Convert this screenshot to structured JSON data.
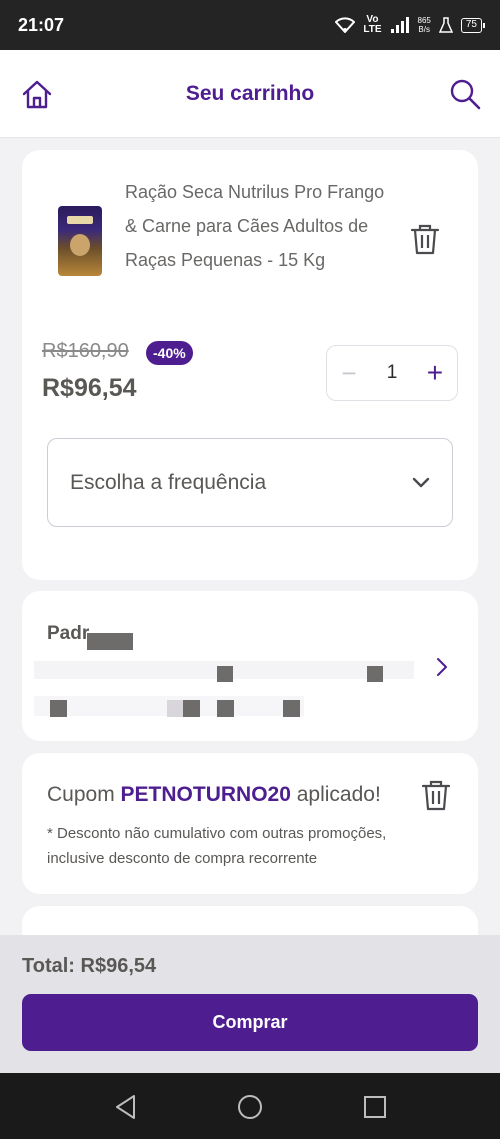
{
  "status_bar": {
    "time": "21:07",
    "network": "Vo\nLTE",
    "speed_value": "865",
    "speed_unit": "B/s",
    "battery": "75"
  },
  "header": {
    "title": "Seu carrinho"
  },
  "cart_item": {
    "name": "Ração Seca Nutrilus Pro Frango & Carne para Cães Adultos de Raças Pequenas - 15 Kg",
    "old_price": "R$160,90",
    "discount": "-40%",
    "price": "R$96,54",
    "quantity": "1",
    "frequency_placeholder": "Escolha a frequência"
  },
  "delivery": {
    "title": "Padr"
  },
  "coupon": {
    "prefix": "Cupom ",
    "code": "PETNOTURNO20",
    "suffix": " aplicado!",
    "note": "* Desconto não cumulativo com outras promoções, inclusive desconto de compra recorrente"
  },
  "footer": {
    "total": "Total: R$96,54",
    "buy_label": "Comprar"
  },
  "colors": {
    "brand": "#4e1e90",
    "background": "#f2f1f4"
  }
}
